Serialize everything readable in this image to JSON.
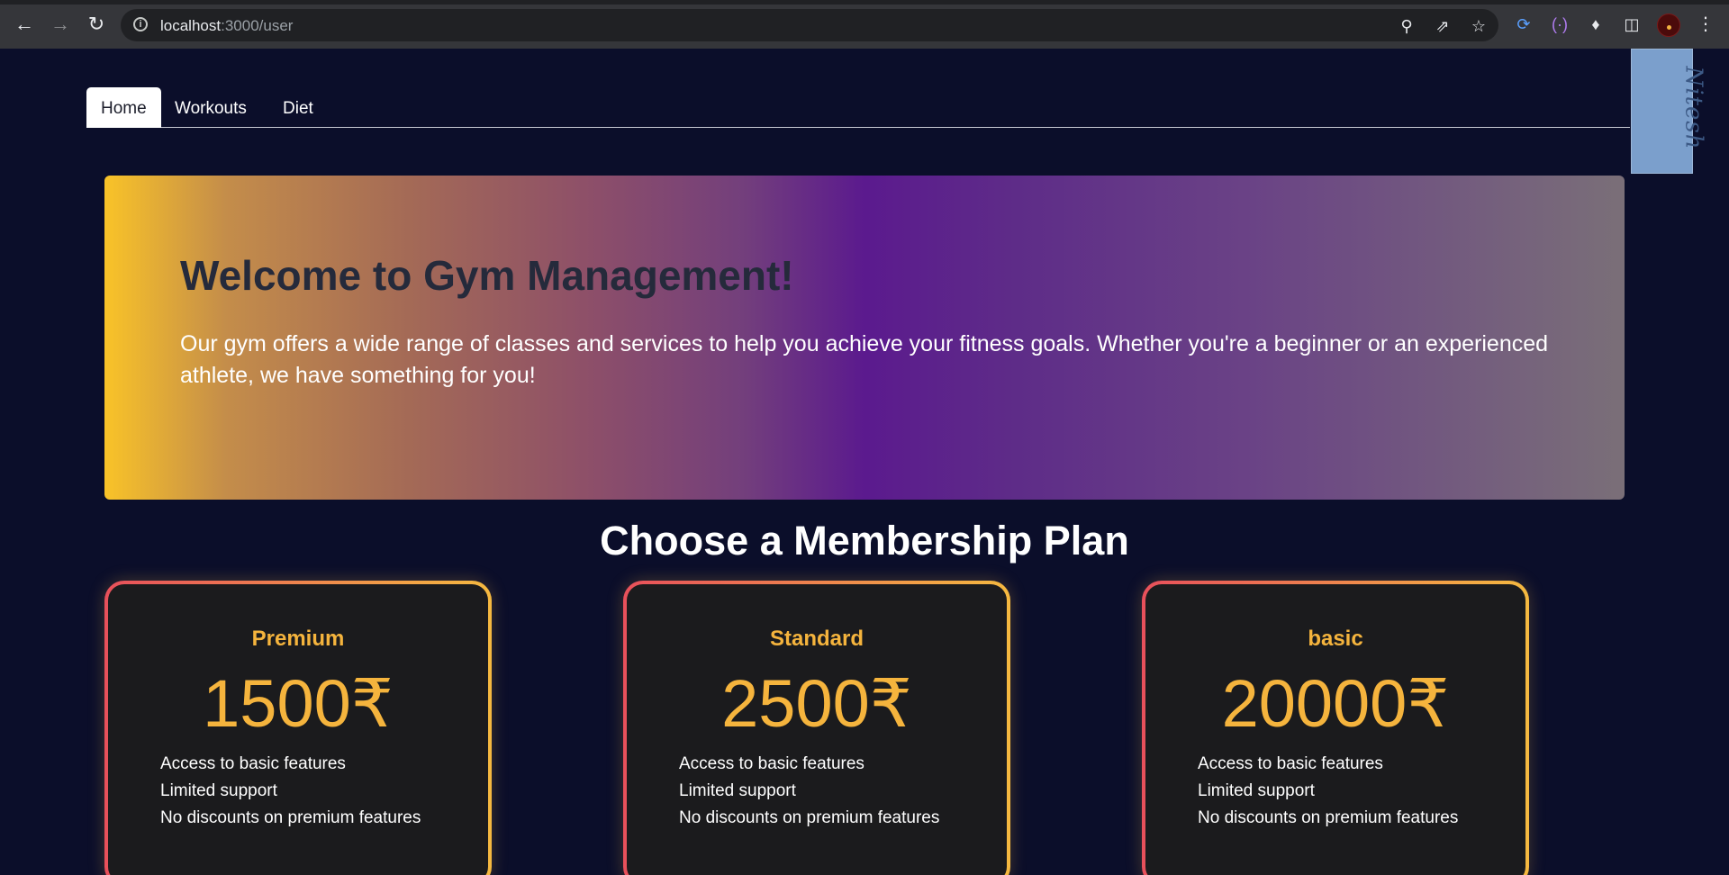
{
  "browser": {
    "url_host": "localhost",
    "url_path": ":3000/user"
  },
  "nav": {
    "tabs": [
      {
        "label": "Home",
        "active": true
      },
      {
        "label": "Workouts",
        "active": false
      },
      {
        "label": "Diet",
        "active": false
      }
    ]
  },
  "hero": {
    "title": "Welcome to Gym Management!",
    "text": "Our gym offers a wide range of classes and services to help you achieve your fitness goals. Whether you're a beginner or an experienced athlete, we have something for you!"
  },
  "plans": {
    "title": "Choose a Membership Plan",
    "items": [
      {
        "name": "Premium",
        "price": "1500₹",
        "features": [
          "Access to basic features",
          "Limited support",
          "No discounts on premium features"
        ]
      },
      {
        "name": "Standard",
        "price": "2500₹",
        "features": [
          "Access to basic features",
          "Limited support",
          "No discounts on premium features"
        ]
      },
      {
        "name": "basic",
        "price": "20000₹",
        "features": [
          "Access to basic features",
          "Limited support",
          "No discounts on premium features"
        ]
      }
    ]
  },
  "colors": {
    "page_bg": "#0b0e2a",
    "accent": "#f5b43d",
    "card_border_start": "#e8505b",
    "card_border_end": "#f5b940"
  },
  "icons": {
    "back": "arrow-left-icon",
    "forward": "arrow-right-icon",
    "reload": "reload-icon",
    "site_info": "info-icon",
    "key": "key-icon",
    "share": "share-icon",
    "star": "star-icon",
    "extensions": "puzzle-icon",
    "sidebar": "sidebar-icon",
    "menu": "menu-dots-icon"
  }
}
